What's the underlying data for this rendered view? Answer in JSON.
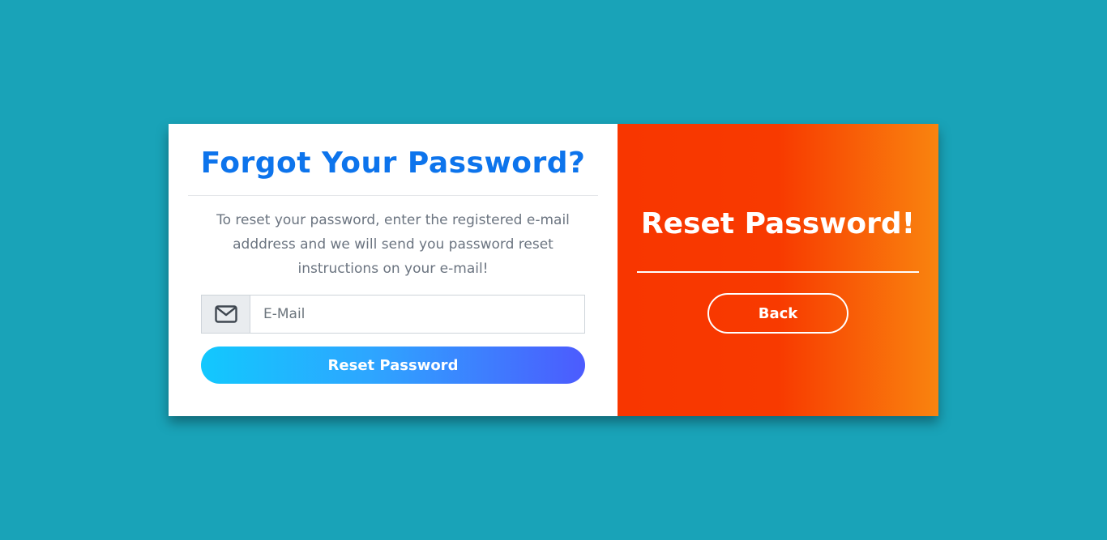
{
  "left": {
    "title": "Forgot Your Password?",
    "description": "To reset your password, enter the registered e-mail adddress and we will send you password reset instructions on your e-mail!",
    "email": {
      "icon": "envelope-icon",
      "placeholder": "E-Mail",
      "value": ""
    },
    "submit_label": "Reset Password"
  },
  "right": {
    "title": "Reset Password!",
    "back_label": "Back"
  },
  "colors": {
    "page_background": "#19a3b8",
    "title_blue": "#0d74ec",
    "gradient_orange_start": "#f83600",
    "gradient_orange_end": "#f9840f",
    "button_gradient_start": "#12c8fe",
    "button_gradient_end": "#4c5bfe"
  }
}
